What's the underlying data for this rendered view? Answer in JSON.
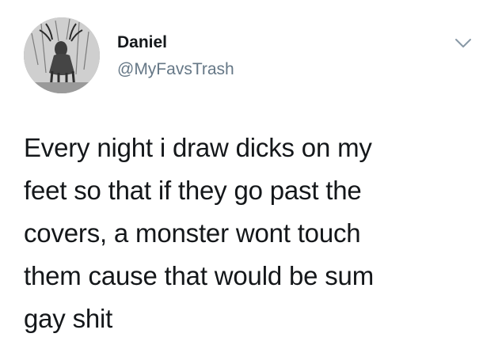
{
  "tweet": {
    "author": {
      "name": "Daniel",
      "handle": "@MyFavsTrash",
      "avatar_icon": "deer-photo-avatar"
    },
    "menu_icon": "chevron-down-icon",
    "text_lines": [
      "Every night i draw dicks on my",
      "feet so that if they go past the",
      "covers, a monster wont touch",
      "them cause that would be sum",
      "gay shit"
    ]
  },
  "colors": {
    "text": "#14171a",
    "secondary": "#657786",
    "background": "#ffffff"
  }
}
